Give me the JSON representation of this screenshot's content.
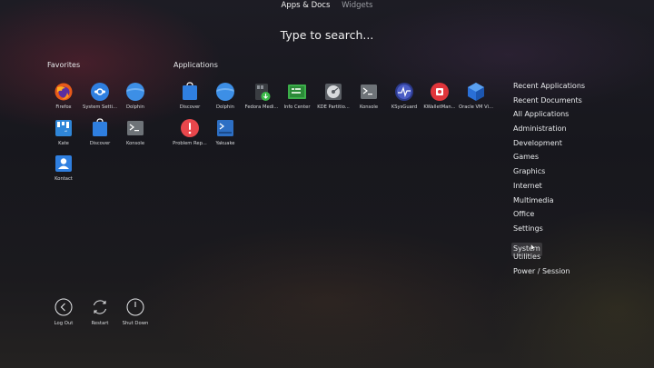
{
  "tabs": [
    "Apps & Docs",
    "Widgets"
  ],
  "search": {
    "placeholder": "Type to search..."
  },
  "favorites": {
    "title": "Favorites",
    "items": [
      {
        "label": "Firefox",
        "icon": "firefox-icon"
      },
      {
        "label": "System Setti...",
        "icon": "system-settings-icon"
      },
      {
        "label": "Dolphin",
        "icon": "dolphin-folder-icon"
      },
      {
        "label": "Kate",
        "icon": "kate-icon"
      },
      {
        "label": "Discover",
        "icon": "discover-icon"
      },
      {
        "label": "Konsole",
        "icon": "konsole-icon"
      },
      {
        "label": "Kontact",
        "icon": "kontact-icon"
      }
    ]
  },
  "applications": {
    "title": "Applications",
    "items": [
      {
        "label": "Discover",
        "icon": "discover-icon"
      },
      {
        "label": "Dolphin",
        "icon": "dolphin-folder-icon"
      },
      {
        "label": "Fedora Medi...",
        "icon": "fedora-media-writer-icon"
      },
      {
        "label": "Info Center",
        "icon": "info-center-icon"
      },
      {
        "label": "KDE Partitio...",
        "icon": "kde-partition-manager-icon"
      },
      {
        "label": "Konsole",
        "icon": "konsole-icon"
      },
      {
        "label": "KSysGuard",
        "icon": "ksysguard-icon"
      },
      {
        "label": "KWalletMan...",
        "icon": "kwallet-manager-icon"
      },
      {
        "label": "Oracle VM Vi...",
        "icon": "virtualbox-icon"
      },
      {
        "label": "Problem Rep...",
        "icon": "problem-reporting-icon"
      },
      {
        "label": "Yakuake",
        "icon": "yakuake-icon"
      }
    ]
  },
  "categories": [
    "Recent Applications",
    "Recent Documents",
    "All Applications",
    "Administration",
    "Development",
    "Games",
    "Graphics",
    "Internet",
    "Multimedia",
    "Office",
    "Settings",
    "System",
    "Utilities",
    "Power / Session"
  ],
  "selected_category": "System",
  "power": [
    {
      "label": "Log Out",
      "icon": "log-out-icon"
    },
    {
      "label": "Restart",
      "icon": "restart-icon"
    },
    {
      "label": "Shut Down",
      "icon": "shut-down-icon"
    }
  ],
  "colors": {
    "accent_blue": "#2f7fe0",
    "folder_blue": "#3d8fe6",
    "selected_bg": "#3a3b40"
  }
}
